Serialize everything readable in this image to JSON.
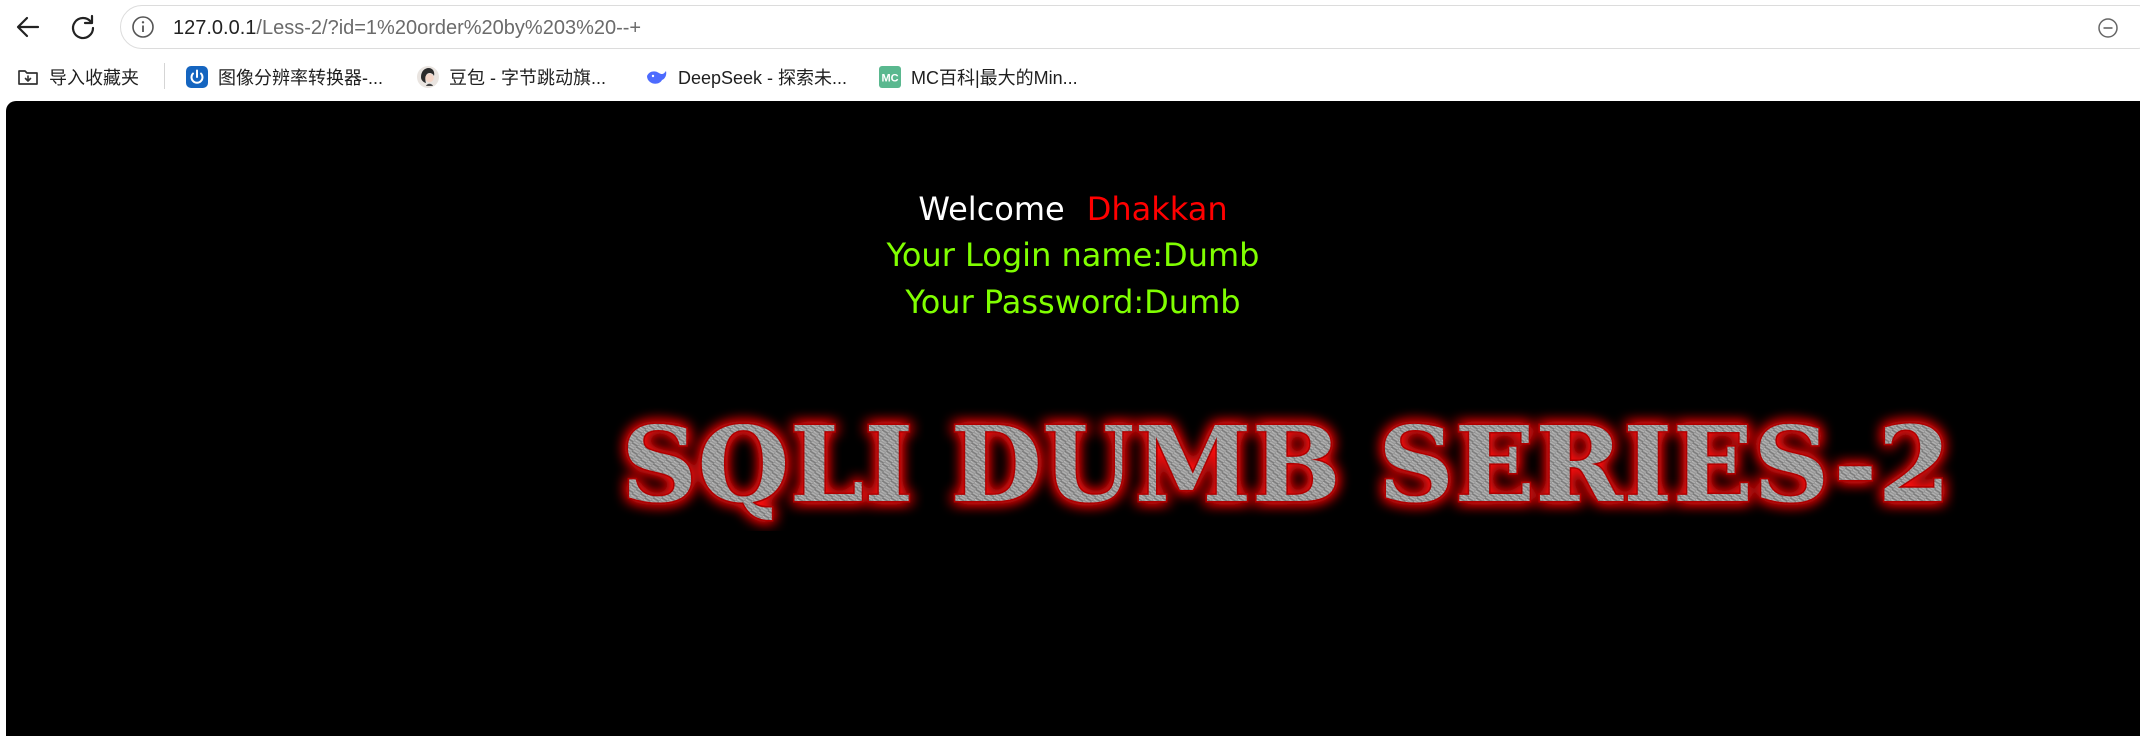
{
  "browser": {
    "url_host": "127.0.0.1",
    "url_path": "/Less-2/?id=1%20order%20by%203%20--+"
  },
  "bookmarks": [
    {
      "label": "导入收藏夹",
      "icon": "import-folder-icon"
    },
    {
      "label": "图像分辨率转换器-...",
      "icon": "power-icon"
    },
    {
      "label": "豆包 - 字节跳动旗...",
      "icon": "doubao-avatar-icon"
    },
    {
      "label": "DeepSeek - 探索未...",
      "icon": "deepseek-whale-icon"
    },
    {
      "label": "MC百科|最大的Min...",
      "icon": "mc-logo-icon"
    }
  ],
  "page": {
    "welcome": "Welcome",
    "name": "Dhakkan",
    "login_line": "Your Login name:Dumb",
    "password_line": "Your Password:Dumb",
    "banner": "SQLI DUMB SERIES-2"
  },
  "colors": {
    "page_bg": "#000000",
    "welcome": "#ffffff",
    "name": "#ff0000",
    "info": "#80ff00",
    "banner_glow": "#ff0000",
    "banner_metal": "#9a9a9a"
  }
}
